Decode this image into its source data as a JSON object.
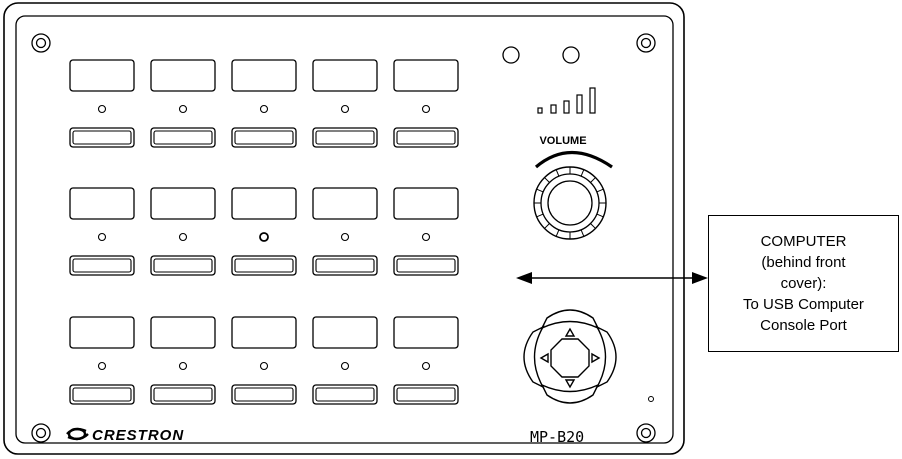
{
  "device": {
    "brand": "CRESTRON",
    "model": "MP-B20",
    "volume_label": "VOLUME",
    "button_rows": 3,
    "button_columns": 5
  },
  "callout": {
    "lines": [
      "COMPUTER",
      "(behind front",
      "cover):",
      "To USB Computer",
      "Console Port"
    ]
  },
  "icons": {
    "navigation": [
      "up-arrow-icon",
      "down-arrow-icon",
      "left-arrow-icon",
      "right-arrow-icon"
    ],
    "arrow": "double-headed-arrow-icon",
    "logo": "crestron-swirl-logo"
  },
  "colors": {
    "line": "#000000",
    "background": "#ffffff"
  }
}
